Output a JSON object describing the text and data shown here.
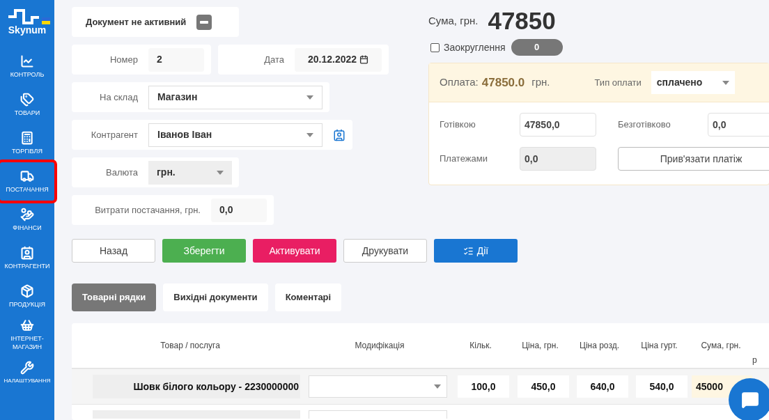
{
  "sidebar": {
    "logo": "Skynum",
    "items": [
      {
        "label": "КОНТРОЛЬ",
        "selected": false
      },
      {
        "label": "ТОВАРИ",
        "selected": false
      },
      {
        "label": "ТОРГІВЛЯ",
        "selected": false
      },
      {
        "label": "ПОСТАЧАННЯ",
        "selected": true
      },
      {
        "label": "ФІНАНСИ",
        "selected": false
      },
      {
        "label": "КОНТРАГЕНТИ",
        "selected": false
      },
      {
        "label": "ПРОДУКЦІЯ",
        "selected": false
      },
      {
        "label": "ІНТЕРНЕТ-МАГАЗИН",
        "selected": false
      },
      {
        "label": "НАЛАШТУВАННЯ",
        "selected": false
      }
    ]
  },
  "document_status": {
    "label": "Документ не активний",
    "active": false
  },
  "form_rows": [
    {
      "fields": [
        {
          "kind": "text",
          "label": "Номер",
          "value": "2"
        },
        {
          "kind": "date",
          "label": "Дата",
          "value": "20.12.2022"
        }
      ]
    },
    {
      "fields": [
        {
          "kind": "select",
          "label": "На склад",
          "value": "Магазин"
        }
      ]
    },
    {
      "fields": [
        {
          "kind": "select_card",
          "label": "Контрагент",
          "value": "Іванов Іван"
        }
      ]
    },
    {
      "fields": [
        {
          "kind": "select_locked",
          "label": "Валюта",
          "value": "грн."
        }
      ]
    },
    {
      "fields": [
        {
          "kind": "text",
          "label": "Витрати постачання, грн.",
          "value": "0,0"
        }
      ]
    }
  ],
  "total": {
    "label": "Сума, грн.",
    "value": "47850"
  },
  "rounding": {
    "label": "Заокруглення",
    "checked": false,
    "value": "0"
  },
  "payment": {
    "label": "Оплата:",
    "amount": "47850.0",
    "currency": "грн.",
    "type_label": "Тип оплати",
    "type_value": "сплачено",
    "cash": {
      "label": "Готівкою",
      "value": "47850,0"
    },
    "cashless": {
      "label": "Безготівково",
      "value": "0,0"
    },
    "payments": {
      "label": "Платежами",
      "value": "0,0",
      "disabled": true
    },
    "link_button": "Прив'язати платіж"
  },
  "buttons": [
    {
      "label": "Назад",
      "kind": "outline"
    },
    {
      "label": "Зберегти",
      "kind": "success"
    },
    {
      "label": "Активувати",
      "kind": "danger"
    },
    {
      "label": "Друкувати",
      "kind": "outline"
    },
    {
      "label": "Дії",
      "kind": "primary"
    }
  ],
  "tabs": [
    {
      "label": "Товарні рядки",
      "selected": true
    },
    {
      "label": "Вихідні документи",
      "selected": false
    },
    {
      "label": "Коментарі",
      "selected": false
    }
  ],
  "table": {
    "columns": [
      "Товар / послуга",
      "Модифікація",
      "Кільк.",
      "Ціна, грн.",
      "Ціна розд.",
      "Ціна гурт.",
      "Сума, грн.",
      "р"
    ],
    "rows": [
      {
        "product": "Шовк білого кольору - 2230000000",
        "quantity": "100,0",
        "price": "450,0",
        "retail_price": "640,0",
        "wholesale_price": "540,0",
        "sum": "45000"
      }
    ]
  }
}
